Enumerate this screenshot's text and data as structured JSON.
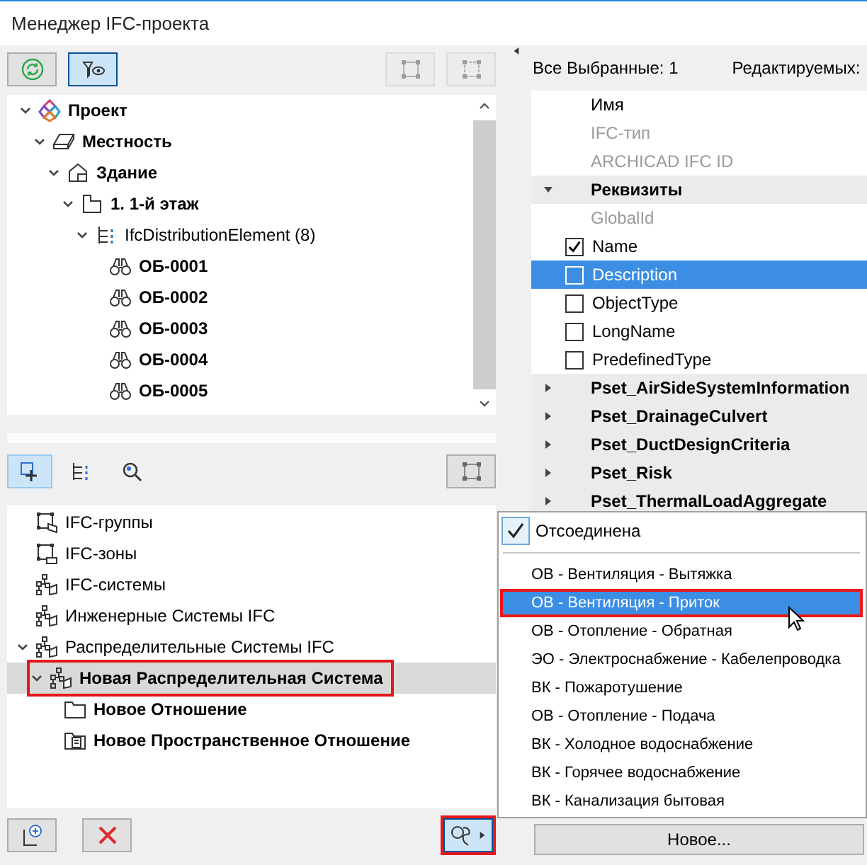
{
  "window": {
    "title": "Менеджер IFC-проекта"
  },
  "toolbar": [
    {
      "kind": "refresh",
      "selected": false,
      "disabled": false
    },
    {
      "kind": "filter_view",
      "selected": true,
      "disabled": false
    },
    {
      "kind": "group_nodes",
      "selected": false,
      "disabled": true
    },
    {
      "kind": "link_nodes",
      "selected": false,
      "disabled": true
    }
  ],
  "project_tree": [
    {
      "kind": "project",
      "label": "Проект",
      "expanded": true,
      "children": [
        {
          "kind": "site",
          "label": "Местность",
          "expanded": true,
          "children": [
            {
              "kind": "building",
              "label": "Здание",
              "expanded": true,
              "children": [
                {
                  "kind": "storey",
                  "label": "1. 1-й этаж",
                  "expanded": true,
                  "children": [
                    {
                      "kind": "ifc_class",
                      "label": "IfcDistributionElement (8)",
                      "expanded": true,
                      "children": [
                        {
                          "kind": "element",
                          "label": "ОБ-0001"
                        },
                        {
                          "kind": "element",
                          "label": "ОБ-0002"
                        },
                        {
                          "kind": "element",
                          "label": "ОБ-0003"
                        },
                        {
                          "kind": "element",
                          "label": "ОБ-0004"
                        },
                        {
                          "kind": "element",
                          "label": "ОБ-0005"
                        }
                      ]
                    }
                  ]
                }
              ]
            }
          ]
        }
      ]
    }
  ],
  "view_tabs": [
    {
      "kind": "assign",
      "selected": true
    },
    {
      "kind": "hierarchy",
      "selected": false
    },
    {
      "kind": "search",
      "selected": false
    }
  ],
  "group_tree": [
    {
      "kind": "category_group",
      "label": "IFC-группы",
      "selected": false,
      "outlined": false
    },
    {
      "kind": "category_zone",
      "label": "IFC-зоны",
      "selected": false,
      "outlined": false
    },
    {
      "kind": "category_system",
      "label": "IFC-системы",
      "selected": false,
      "outlined": false
    },
    {
      "kind": "category_engineering",
      "label": "Инженерные Системы IFC",
      "selected": false,
      "outlined": false
    },
    {
      "kind": "category_distribution",
      "label": "Распределительные Системы IFC",
      "selected": false,
      "outlined": false,
      "expanded": true,
      "children": [
        {
          "kind": "distribution_system",
          "label": "Новая Распределительная Система",
          "selected": true,
          "outlined": true,
          "expanded": true,
          "children": [
            {
              "kind": "relation",
              "label": "Новое Отношение",
              "selected": false,
              "outlined": false
            },
            {
              "kind": "spatial_relation",
              "label": "Новое Пространственное Отношение",
              "selected": false,
              "outlined": false
            }
          ]
        }
      ]
    }
  ],
  "bottom_buttons": [
    {
      "kind": "add",
      "pressed": false,
      "outlined": false
    },
    {
      "kind": "delete",
      "pressed": false,
      "outlined": false
    },
    {
      "kind": "system_menu",
      "pressed": true,
      "outlined": true
    }
  ],
  "selection_header": {
    "selected_count": "Все Выбранные: 1",
    "editable_label": "Редактируемых:"
  },
  "properties": [
    {
      "kind": "field",
      "label": "Имя",
      "disabled": false
    },
    {
      "kind": "field",
      "label": "IFC-тип",
      "disabled": true
    },
    {
      "kind": "field",
      "label": "ARCHICAD IFC ID",
      "disabled": true
    },
    {
      "kind": "group",
      "label": "Реквизиты",
      "expanded": true
    },
    {
      "kind": "field",
      "label": "GlobalId",
      "disabled": true
    },
    {
      "kind": "check",
      "label": "Name",
      "checked": true,
      "selected": false
    },
    {
      "kind": "check",
      "label": "Description",
      "checked": false,
      "selected": true
    },
    {
      "kind": "check",
      "label": "ObjectType",
      "checked": false,
      "selected": false
    },
    {
      "kind": "check",
      "label": "LongName",
      "checked": false,
      "selected": false
    },
    {
      "kind": "check",
      "label": "PredefinedType",
      "checked": false,
      "selected": false
    },
    {
      "kind": "group",
      "label": "Pset_AirSideSystemInformation",
      "expanded": false
    },
    {
      "kind": "group",
      "label": "Pset_DrainageCulvert",
      "expanded": false
    },
    {
      "kind": "group",
      "label": "Pset_DuctDesignCriteria",
      "expanded": false
    },
    {
      "kind": "group",
      "label": "Pset_Risk",
      "expanded": false
    },
    {
      "kind": "group",
      "label": "Pset_ThermalLoadAggregate",
      "expanded": false
    }
  ],
  "popup_menu": {
    "check": {
      "label": "Отсоединена",
      "checked": true
    },
    "items": [
      {
        "label": "ОВ - Вентиляция - Вытяжка",
        "selected": false,
        "outlined": false
      },
      {
        "label": "ОВ - Вентиляция - Приток",
        "selected": true,
        "outlined": true
      },
      {
        "label": "ОВ - Отопление - Обратная",
        "selected": false,
        "outlined": false
      },
      {
        "label": "ЭО - Электроснабжение - Кабелепроводка",
        "selected": false,
        "outlined": false
      },
      {
        "label": "ВК - Пожаротушение",
        "selected": false,
        "outlined": false
      },
      {
        "label": "ОВ - Отопление - Подача",
        "selected": false,
        "outlined": false
      },
      {
        "label": "ВК - Холодное водоснабжение",
        "selected": false,
        "outlined": false
      },
      {
        "label": "ВК - Горячее водоснабжение",
        "selected": false,
        "outlined": false
      },
      {
        "label": "ВК - Канализация бытовая",
        "selected": false,
        "outlined": false
      }
    ]
  },
  "new_button": "Новое..."
}
